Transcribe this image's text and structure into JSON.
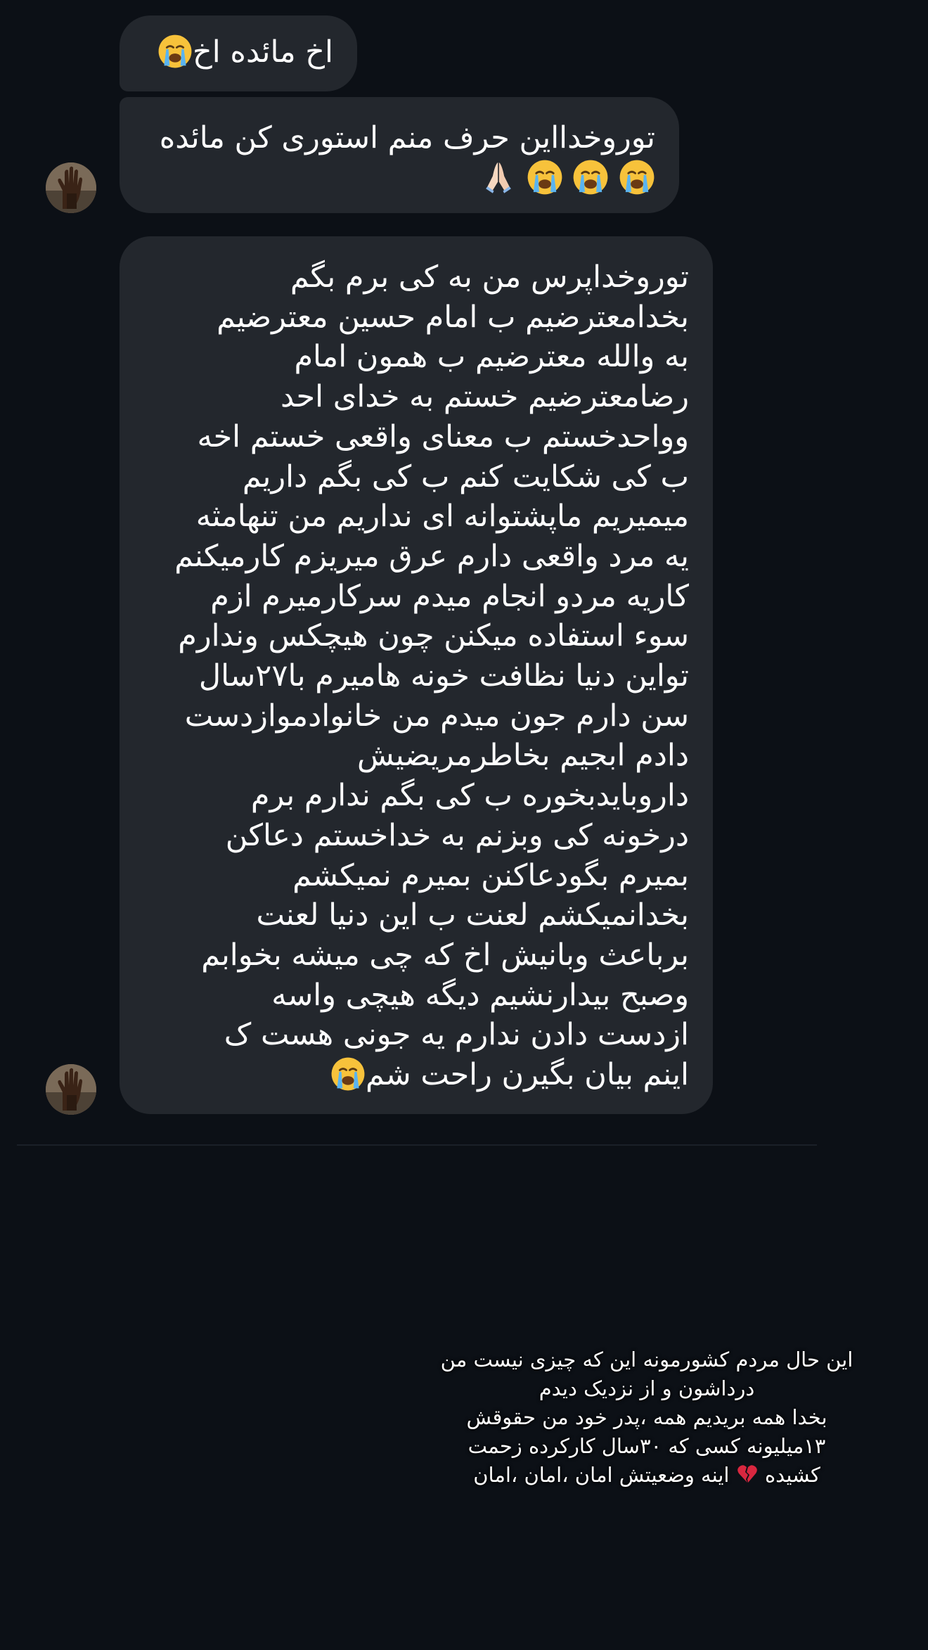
{
  "messages": [
    {
      "text": "اخ مائده اخ",
      "emoji": [
        "sob-emoji"
      ]
    },
    {
      "lines": [
        "توروخدااین حرف منم استوری کن مائده"
      ],
      "emoji": [
        "sob-emoji",
        "sob-emoji",
        "sob-emoji",
        "pray-emoji"
      ]
    },
    {
      "lines": [
        "توروخداپرس من به کی برم بگم",
        "بخدامعترضیم ب امام حسین معترضیم",
        "به والله معترضیم ب همون امام",
        "رضامعترضیم خستم به خدای احد",
        "وواحدخستم ب معنای واقعی خستم اخه",
        "ب کی شکایت کنم ب کی بگم داریم",
        "میمیریم ماپشتوانه ای نداریم من تنهامثه",
        "یه مرد واقعی دارم عرق میریزم کارمیکنم",
        "کاریه مردو انجام میدم سرکارمیرم ازم",
        "سوء استفاده میکنن چون هیچکس وندارم",
        "تواین دنیا  نظافت خونه هامیرم با۲۷سال",
        "سن دارم جون میدم من خانوادموازدست",
        "دادم  ابجیم بخاطرمریضیش",
        "داروبایدبخوره ب کی بگم ندارم برم",
        "درخونه کی وبزنم به خداخستم دعاکن",
        "بمیرم  بگودعاکنن بمیرم نمیکشم",
        "بخدانمیکشم لعنت ب این دنیا لعنت",
        "برباعث وبانیش اخ که چی میشه بخوابم",
        "وصبح بیدارنشیم دیگه هیچی واسه",
        "ازدست دادن ندارم یه جونی هست ک",
        "اینم بیان بگیرن راحت شم"
      ],
      "emoji": [
        "sob-emoji"
      ]
    }
  ],
  "caption": {
    "lines": [
      "این حال مردم کشورمونه این که چیزی نیست من",
      "درداشون و از نزدیک دیدم",
      "بخدا همه بریدیم همه ،پدر خود من حقوقش",
      "۱۳میلیونه کسی که ۳۰سال کارکرده زحمت",
      "کشیده",
      "اینه وضعیتش امان ،امان ،امان"
    ],
    "emoji": "broken-heart-emoji"
  },
  "avatar": "raised-hand-avatar",
  "colors": {
    "background": "#0c1016",
    "bubble": "#23272d",
    "text": "#ffffff"
  }
}
